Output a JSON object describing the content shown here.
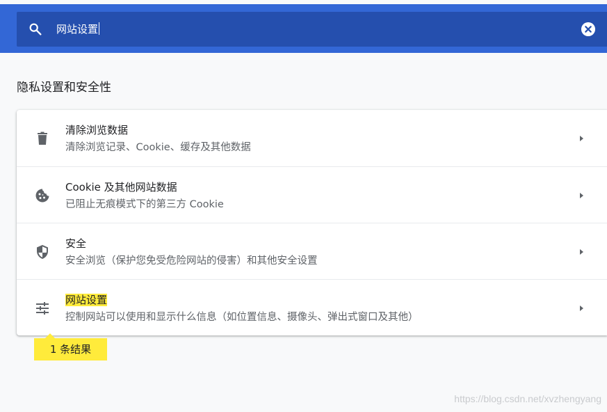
{
  "search": {
    "value": "网站设置",
    "icon": "search-icon",
    "clear_icon": "clear-icon"
  },
  "section": {
    "title": "隐私设置和安全性"
  },
  "items": [
    {
      "icon": "trash-icon",
      "title": "清除浏览数据",
      "subtitle": "清除浏览记录、Cookie、缓存及其他数据"
    },
    {
      "icon": "cookie-icon",
      "title": "Cookie 及其他网站数据",
      "subtitle": "已阻止无痕模式下的第三方 Cookie"
    },
    {
      "icon": "shield-icon",
      "title": "安全",
      "subtitle": "安全浏览（保护您免受危险网站的侵害）和其他安全设置"
    },
    {
      "icon": "tune-icon",
      "title": "网站设置",
      "subtitle": "控制网站可以使用和显示什么信息（如位置信息、摄像头、弹出式窗口及其他）"
    }
  ],
  "result_count": "1 条结果",
  "watermark": "https://blog.csdn.net/xvzhengyang",
  "colors": {
    "header": "#3367d6",
    "search_box": "#254fae",
    "highlight": "#ffeb3b"
  }
}
